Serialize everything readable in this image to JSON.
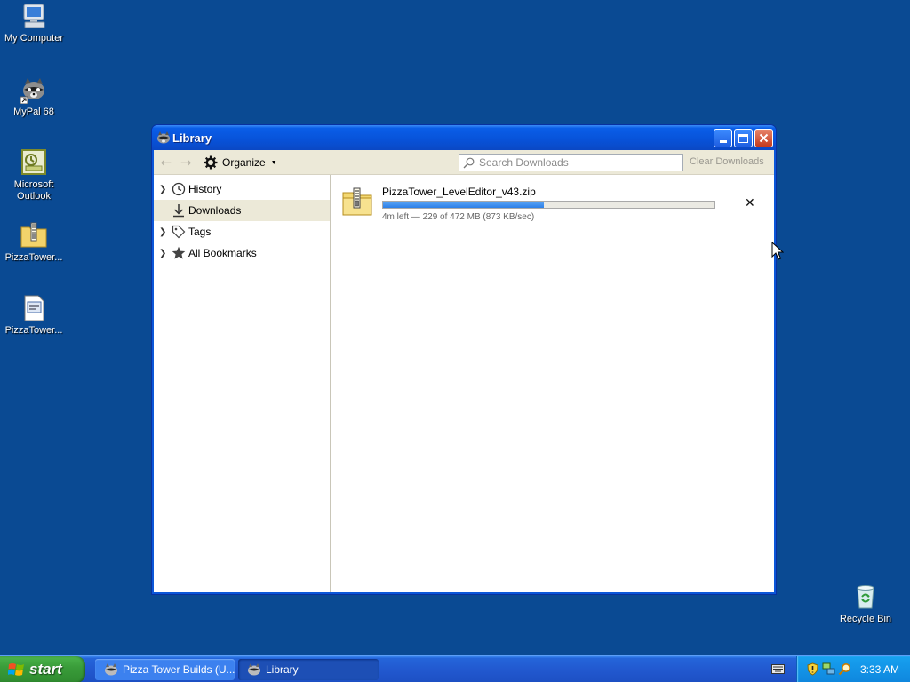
{
  "desktop": {
    "icons": [
      {
        "label": "My Computer",
        "icon": "my-computer-icon"
      },
      {
        "label": "MyPal 68",
        "icon": "raccoon-browser-shortcut-icon"
      },
      {
        "label": "Microsoft Outlook",
        "icon": "outlook-icon"
      },
      {
        "label": "PizzaTower...",
        "icon": "zip-folder-icon"
      },
      {
        "label": "PizzaTower...",
        "icon": "document-icon"
      },
      {
        "label": "Recycle Bin",
        "icon": "recycle-bin-icon"
      }
    ]
  },
  "window": {
    "title": "Library",
    "toolbar": {
      "organize_label": "Organize",
      "search_placeholder": "Search Downloads",
      "clear_label": "Clear Downloads"
    },
    "sidebar": {
      "items": [
        {
          "label": "History",
          "icon": "clock-icon",
          "expandable": true,
          "selected": false
        },
        {
          "label": "Downloads",
          "icon": "download-arrow-icon",
          "expandable": false,
          "selected": true
        },
        {
          "label": "Tags",
          "icon": "tag-icon",
          "expandable": true,
          "selected": false
        },
        {
          "label": "All Bookmarks",
          "icon": "star-icon",
          "expandable": true,
          "selected": false
        }
      ]
    },
    "downloads": [
      {
        "filename": "PizzaTower_LevelEditor_v43.zip",
        "status": "4m left — 229 of 472 MB (873 KB/sec)",
        "progress_fraction": 0.485,
        "icon": "zip-file-icon"
      }
    ]
  },
  "taskbar": {
    "start_label": "start",
    "tasks": [
      {
        "label": "Pizza Tower Builds (U...",
        "active": false
      },
      {
        "label": "Library",
        "active": true
      }
    ],
    "clock": "3:33 AM"
  },
  "colors": {
    "desktop_bg": "#0a4a93",
    "titlebar": "#0852d8",
    "progress_fill": "#2d7fe6",
    "start_green": "#3a9d3a",
    "tray_bg": "#0f86dd"
  }
}
